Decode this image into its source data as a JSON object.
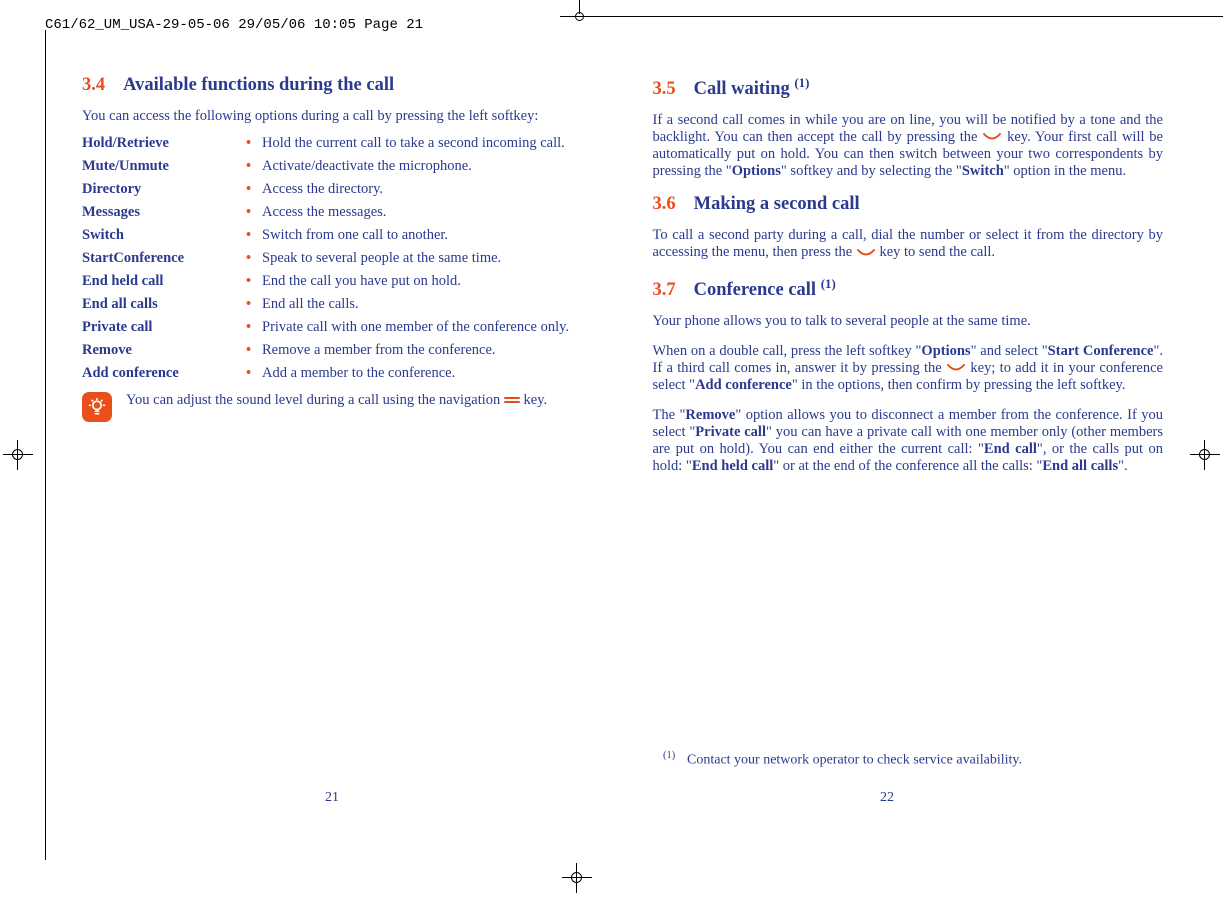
{
  "header": "C61/62_UM_USA-29-05-06  29/05/06  10:05  Page 21",
  "left": {
    "secnum": "3.4",
    "title": "Available functions during the call",
    "intro": "You can access the following options during a call by pressing the left softkey:",
    "functions": [
      {
        "term": "Hold/Retrieve",
        "desc": "Hold the current call to take a second incoming call."
      },
      {
        "term": "Mute/Unmute",
        "desc": "Activate/deactivate the microphone."
      },
      {
        "term": "Directory",
        "desc": "Access the directory."
      },
      {
        "term": "Messages",
        "desc": "Access the messages."
      },
      {
        "term": "Switch",
        "desc": "Switch from one call to another."
      },
      {
        "term": "StartConference",
        "desc": "Speak to several people at the same time."
      },
      {
        "term": "End held call",
        "desc": "End the call you have put on hold."
      },
      {
        "term": "End all calls",
        "desc": "End all the calls."
      },
      {
        "term": "Private call",
        "desc": "Private call with one member of the conference only."
      },
      {
        "term": "Remove",
        "desc": "Remove a member from the conference."
      },
      {
        "term": "Add conference",
        "desc": "Add a member to the conference."
      }
    ],
    "tip_pre": "You can adjust the sound level during a call using the navigation ",
    "tip_post": " key.",
    "pagenum": "21"
  },
  "right": {
    "sections": [
      {
        "secnum": "3.5",
        "title": "Call waiting",
        "sup": "(1)",
        "paras": [
          {
            "runs": [
              {
                "t": "If a second call comes in while you are on line, you will be notified by a tone and the backlight. You can then accept the call by pressing the "
              },
              {
                "key": true
              },
              {
                "t": " key. Your first call will be automatically put on hold. You can then switch between your two correspondents by pressing the \""
              },
              {
                "b": "Options"
              },
              {
                "t": "\" softkey and by selecting the \""
              },
              {
                "b": "Switch"
              },
              {
                "t": "\" option in the menu."
              }
            ]
          }
        ]
      },
      {
        "secnum": "3.6",
        "title": "Making a second call",
        "paras": [
          {
            "runs": [
              {
                "t": "To call a second party during a call, dial the number or select it from the directory by accessing the menu, then press the "
              },
              {
                "key": true
              },
              {
                "t": " key to send the call."
              }
            ]
          }
        ]
      },
      {
        "secnum": "3.7",
        "title": "Conference call",
        "sup": "(1)",
        "paras": [
          {
            "runs": [
              {
                "t": "Your phone allows you to talk to several people at the same time."
              }
            ]
          },
          {
            "runs": [
              {
                "t": "When on a double call, press the left softkey \""
              },
              {
                "b": "Options"
              },
              {
                "t": "\" and select \""
              },
              {
                "b": "Start Conference"
              },
              {
                "t": "\". If a third call comes in, answer it by pressing the "
              },
              {
                "key": true
              },
              {
                "t": " key; to add it in your conference select \""
              },
              {
                "b": "Add conference"
              },
              {
                "t": "\" in the options, then confirm by pressing the left softkey."
              }
            ]
          },
          {
            "runs": [
              {
                "t": "The \""
              },
              {
                "b": "Remove"
              },
              {
                "t": "\" option allows you to disconnect a member from the conference. If you select \""
              },
              {
                "b": "Private call"
              },
              {
                "t": "\" you can have a private call with one member only (other members are put on hold). You can end either the current call: \""
              },
              {
                "b": "End call"
              },
              {
                "t": "\", or the calls put on hold: \""
              },
              {
                "b": "End held call"
              },
              {
                "t": "\" or at the end of the conference all the calls: \""
              },
              {
                "b": "End all calls"
              },
              {
                "t": "\"."
              }
            ]
          }
        ]
      }
    ],
    "footnote_mark": "(1)",
    "footnote": "Contact your network operator to check service availability.",
    "pagenum": "22"
  }
}
